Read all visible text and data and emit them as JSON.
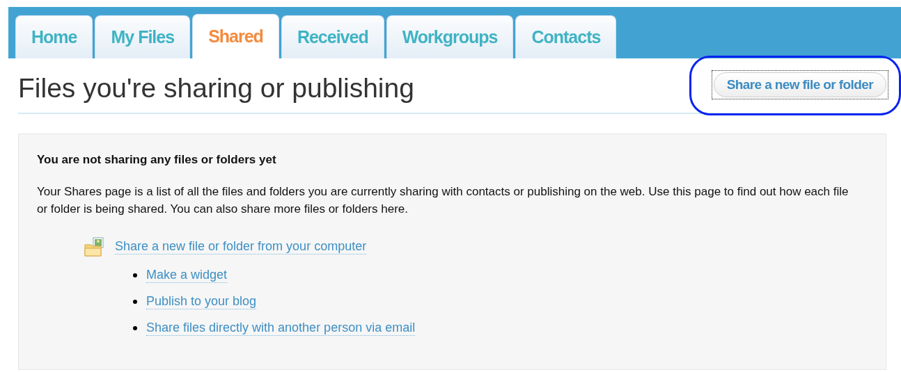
{
  "tabs": [
    {
      "label": "Home",
      "selected": false
    },
    {
      "label": "My Files",
      "selected": false
    },
    {
      "label": "Shared",
      "selected": true
    },
    {
      "label": "Received",
      "selected": false
    },
    {
      "label": "Workgroups",
      "selected": false
    },
    {
      "label": "Contacts",
      "selected": false
    }
  ],
  "page": {
    "title": "Files you're sharing or publishing",
    "action_button": "Share a new file or folder",
    "action_highlighted": true
  },
  "empty_state": {
    "heading": "You are not sharing any files or folders yet",
    "description": "Your Shares page is a list of all the files and folders you are currently sharing with contacts or publishing on the web. Use this page to find out how each file or folder is being shared. You can also share more files or folders here.",
    "primary_link": "Share a new file or folder from your computer",
    "links": [
      "Make a widget",
      "Publish to your blog",
      "Share files directly with another person via email"
    ]
  }
}
